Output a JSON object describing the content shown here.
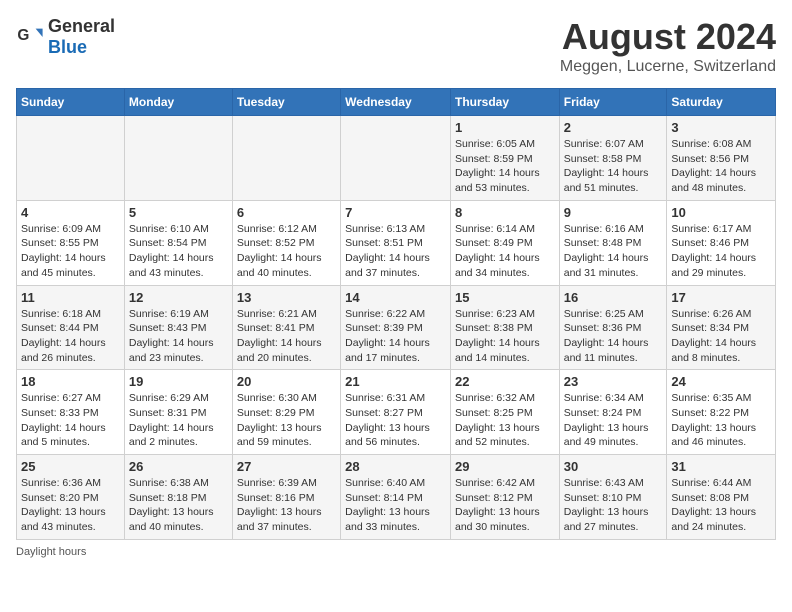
{
  "header": {
    "logo_general": "General",
    "logo_blue": "Blue",
    "main_title": "August 2024",
    "subtitle": "Meggen, Lucerne, Switzerland"
  },
  "calendar": {
    "days_of_week": [
      "Sunday",
      "Monday",
      "Tuesday",
      "Wednesday",
      "Thursday",
      "Friday",
      "Saturday"
    ],
    "weeks": [
      [
        {
          "day": "",
          "info": ""
        },
        {
          "day": "",
          "info": ""
        },
        {
          "day": "",
          "info": ""
        },
        {
          "day": "",
          "info": ""
        },
        {
          "day": "1",
          "info": "Sunrise: 6:05 AM\nSunset: 8:59 PM\nDaylight: 14 hours and 53 minutes."
        },
        {
          "day": "2",
          "info": "Sunrise: 6:07 AM\nSunset: 8:58 PM\nDaylight: 14 hours and 51 minutes."
        },
        {
          "day": "3",
          "info": "Sunrise: 6:08 AM\nSunset: 8:56 PM\nDaylight: 14 hours and 48 minutes."
        }
      ],
      [
        {
          "day": "4",
          "info": "Sunrise: 6:09 AM\nSunset: 8:55 PM\nDaylight: 14 hours and 45 minutes."
        },
        {
          "day": "5",
          "info": "Sunrise: 6:10 AM\nSunset: 8:54 PM\nDaylight: 14 hours and 43 minutes."
        },
        {
          "day": "6",
          "info": "Sunrise: 6:12 AM\nSunset: 8:52 PM\nDaylight: 14 hours and 40 minutes."
        },
        {
          "day": "7",
          "info": "Sunrise: 6:13 AM\nSunset: 8:51 PM\nDaylight: 14 hours and 37 minutes."
        },
        {
          "day": "8",
          "info": "Sunrise: 6:14 AM\nSunset: 8:49 PM\nDaylight: 14 hours and 34 minutes."
        },
        {
          "day": "9",
          "info": "Sunrise: 6:16 AM\nSunset: 8:48 PM\nDaylight: 14 hours and 31 minutes."
        },
        {
          "day": "10",
          "info": "Sunrise: 6:17 AM\nSunset: 8:46 PM\nDaylight: 14 hours and 29 minutes."
        }
      ],
      [
        {
          "day": "11",
          "info": "Sunrise: 6:18 AM\nSunset: 8:44 PM\nDaylight: 14 hours and 26 minutes."
        },
        {
          "day": "12",
          "info": "Sunrise: 6:19 AM\nSunset: 8:43 PM\nDaylight: 14 hours and 23 minutes."
        },
        {
          "day": "13",
          "info": "Sunrise: 6:21 AM\nSunset: 8:41 PM\nDaylight: 14 hours and 20 minutes."
        },
        {
          "day": "14",
          "info": "Sunrise: 6:22 AM\nSunset: 8:39 PM\nDaylight: 14 hours and 17 minutes."
        },
        {
          "day": "15",
          "info": "Sunrise: 6:23 AM\nSunset: 8:38 PM\nDaylight: 14 hours and 14 minutes."
        },
        {
          "day": "16",
          "info": "Sunrise: 6:25 AM\nSunset: 8:36 PM\nDaylight: 14 hours and 11 minutes."
        },
        {
          "day": "17",
          "info": "Sunrise: 6:26 AM\nSunset: 8:34 PM\nDaylight: 14 hours and 8 minutes."
        }
      ],
      [
        {
          "day": "18",
          "info": "Sunrise: 6:27 AM\nSunset: 8:33 PM\nDaylight: 14 hours and 5 minutes."
        },
        {
          "day": "19",
          "info": "Sunrise: 6:29 AM\nSunset: 8:31 PM\nDaylight: 14 hours and 2 minutes."
        },
        {
          "day": "20",
          "info": "Sunrise: 6:30 AM\nSunset: 8:29 PM\nDaylight: 13 hours and 59 minutes."
        },
        {
          "day": "21",
          "info": "Sunrise: 6:31 AM\nSunset: 8:27 PM\nDaylight: 13 hours and 56 minutes."
        },
        {
          "day": "22",
          "info": "Sunrise: 6:32 AM\nSunset: 8:25 PM\nDaylight: 13 hours and 52 minutes."
        },
        {
          "day": "23",
          "info": "Sunrise: 6:34 AM\nSunset: 8:24 PM\nDaylight: 13 hours and 49 minutes."
        },
        {
          "day": "24",
          "info": "Sunrise: 6:35 AM\nSunset: 8:22 PM\nDaylight: 13 hours and 46 minutes."
        }
      ],
      [
        {
          "day": "25",
          "info": "Sunrise: 6:36 AM\nSunset: 8:20 PM\nDaylight: 13 hours and 43 minutes."
        },
        {
          "day": "26",
          "info": "Sunrise: 6:38 AM\nSunset: 8:18 PM\nDaylight: 13 hours and 40 minutes."
        },
        {
          "day": "27",
          "info": "Sunrise: 6:39 AM\nSunset: 8:16 PM\nDaylight: 13 hours and 37 minutes."
        },
        {
          "day": "28",
          "info": "Sunrise: 6:40 AM\nSunset: 8:14 PM\nDaylight: 13 hours and 33 minutes."
        },
        {
          "day": "29",
          "info": "Sunrise: 6:42 AM\nSunset: 8:12 PM\nDaylight: 13 hours and 30 minutes."
        },
        {
          "day": "30",
          "info": "Sunrise: 6:43 AM\nSunset: 8:10 PM\nDaylight: 13 hours and 27 minutes."
        },
        {
          "day": "31",
          "info": "Sunrise: 6:44 AM\nSunset: 8:08 PM\nDaylight: 13 hours and 24 minutes."
        }
      ]
    ]
  },
  "footer": {
    "note": "Daylight hours"
  }
}
